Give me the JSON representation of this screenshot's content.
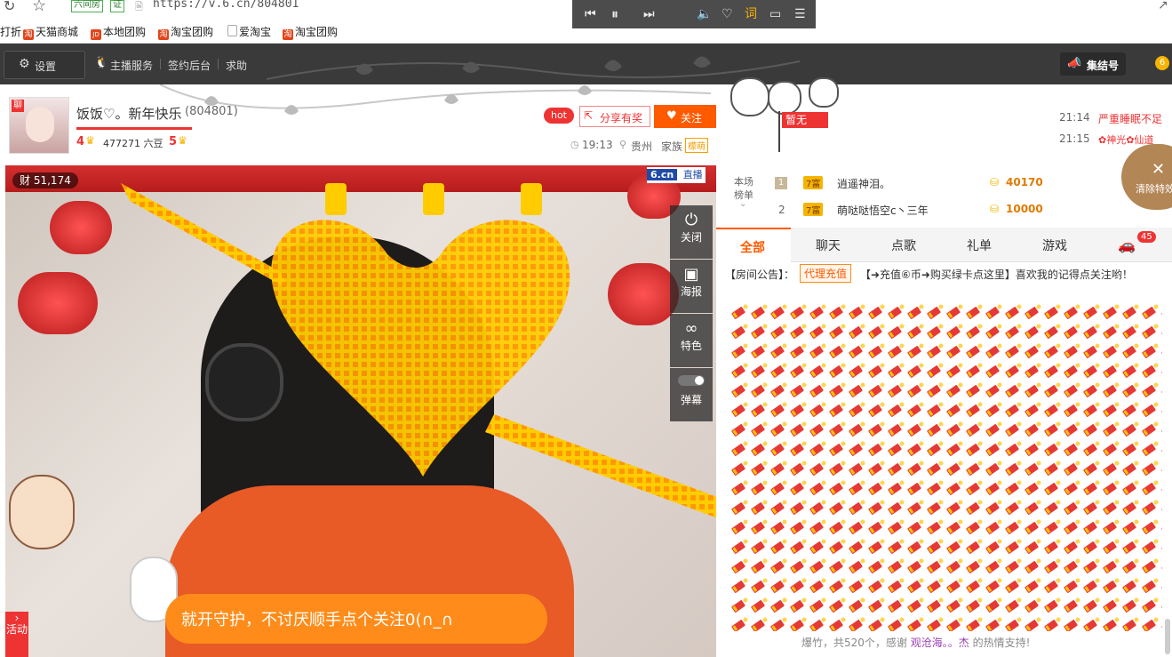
{
  "browser": {
    "badge": "六间房",
    "verify": "证",
    "url": "https://v.6.cn/804801"
  },
  "bookmarks": [
    {
      "label": "打折"
    },
    {
      "label": "天猫商城",
      "icon": "淘"
    },
    {
      "label": "本地团购",
      "icon": "JD"
    },
    {
      "label": "淘宝团购",
      "icon": "淘"
    },
    {
      "label": "爱淘宝"
    },
    {
      "label": "淘宝团购",
      "icon": "淘"
    }
  ],
  "media": {
    "lyrics": "词"
  },
  "nav": {
    "settings": "设置",
    "anchor_service": "主播服务",
    "contract": "签约后台",
    "help": "求助",
    "assemble": "集结号"
  },
  "streamer": {
    "name": "饭饭♡。新年快乐",
    "room_id": "(804801)",
    "level": "4",
    "beans": "477271 六豆",
    "rank": "5",
    "time": "19:13",
    "location": "贵州",
    "family_label": "家族",
    "family": "檬萌"
  },
  "actions": {
    "hot": "hot",
    "share": "分享有奖",
    "follow": "关注"
  },
  "guard": {
    "label": "暂无"
  },
  "chat_preview": [
    {
      "time": "21:14",
      "text": "严重睡眠不足"
    },
    {
      "time": "21:15",
      "text": "✿神光✿仙道"
    }
  ],
  "video": {
    "fans_prefix": "财",
    "fans": "51,174",
    "brand": "6.cn",
    "live": "直播",
    "marquee": "就开守护，不讨厌顺手点个关注0(∩_∩",
    "activity": "活动"
  },
  "side_tools": [
    {
      "label": "关闭"
    },
    {
      "label": "海报"
    },
    {
      "label": "特色"
    },
    {
      "label": "弹幕"
    }
  ],
  "clear_effects": "清除特效",
  "ranking": {
    "header1": "本场",
    "header2": "榜单",
    "rows": [
      {
        "rank": "1",
        "badge": "7富",
        "user": "逍遥神泪。",
        "score": "40170"
      },
      {
        "rank": "2",
        "badge": "7富",
        "user": "萌哒哒悟空c丶三年",
        "score": "10000"
      }
    ]
  },
  "tabs": [
    {
      "label": "全部"
    },
    {
      "label": "聊天"
    },
    {
      "label": "点歌"
    },
    {
      "label": "礼单"
    },
    {
      "label": "游戏"
    }
  ],
  "car_count": "45",
  "announce": {
    "label": "【房间公告】：",
    "button": "代理充值",
    "text": "【➜充值⑥币➜购买绿卡点这里】喜欢我的记得点关注哟！"
  },
  "gift_footer": {
    "prefix": "爆竹，共520个，感谢",
    "user": "观沧海。。杰",
    "suffix": "的热情支持!"
  },
  "colors": {
    "accent": "#ff5a00",
    "nav_bg": "#3a3a3a"
  }
}
